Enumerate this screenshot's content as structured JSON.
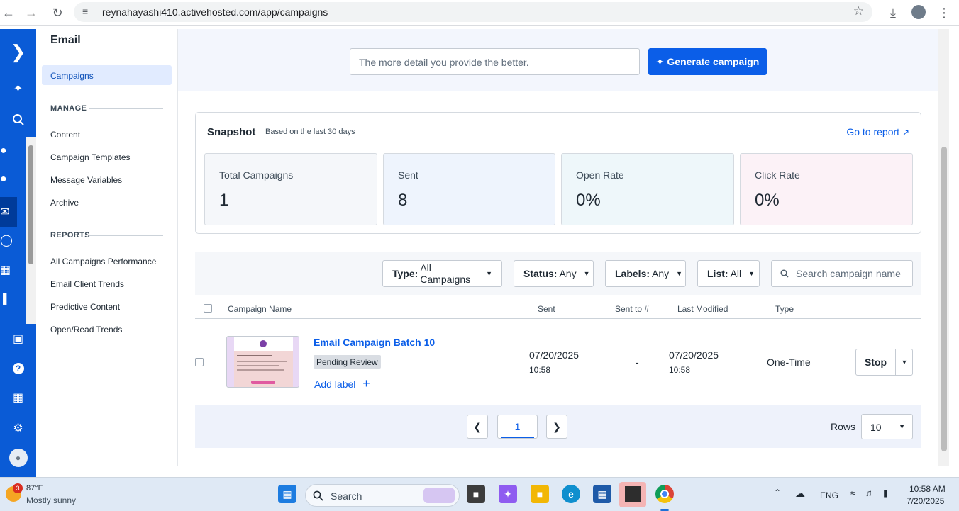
{
  "browser": {
    "url": "reynahayashi410.activehosted.com/app/campaigns"
  },
  "sidebar": {
    "title": "Email",
    "active_item": "Campaigns",
    "manage_heading": "MANAGE",
    "manage_items": [
      "Content",
      "Campaign Templates",
      "Message Variables",
      "Archive"
    ],
    "reports_heading": "REPORTS",
    "report_items": [
      "All Campaigns Performance",
      "Email Client Trends",
      "Predictive Content",
      "Open/Read Trends"
    ]
  },
  "generator": {
    "placeholder": "The more detail you provide the better.",
    "button_label": "Generate campaign"
  },
  "snapshot": {
    "title": "Snapshot",
    "subtitle": "Based on the last 30 days",
    "report_link": "Go to report",
    "stats": [
      {
        "label": "Total Campaigns",
        "value": "1",
        "color": "#f5f7fa"
      },
      {
        "label": "Sent",
        "value": "8",
        "color": "#eef4fd"
      },
      {
        "label": "Open Rate",
        "value": "0%",
        "color": "#eef7fa"
      },
      {
        "label": "Click Rate",
        "value": "0%",
        "color": "#fcf2f7"
      }
    ]
  },
  "filters": {
    "type": {
      "label": "Type:",
      "value": "All Campaigns"
    },
    "status": {
      "label": "Status:",
      "value": "Any"
    },
    "labels": {
      "label": "Labels:",
      "value": "Any"
    },
    "list": {
      "label": "List:",
      "value": "All"
    },
    "search_placeholder": "Search campaign name"
  },
  "table": {
    "headers": {
      "name": "Campaign Name",
      "sent": "Sent",
      "sent_to": "Sent to #",
      "modified": "Last Modified",
      "type": "Type"
    },
    "rows": [
      {
        "name": "Email Campaign Batch 10",
        "status": "Pending Review",
        "add_label": "Add label",
        "sent_date": "07/20/2025",
        "sent_time": "10:58",
        "sent_to": "-",
        "modified_date": "07/20/2025",
        "modified_time": "10:58",
        "type": "One-Time",
        "action": "Stop"
      }
    ]
  },
  "pagination": {
    "current_page": "1",
    "rows_label": "Rows",
    "rows_value": "10"
  },
  "taskbar": {
    "weather_badge": "3",
    "temperature": "87°F",
    "weather": "Mostly sunny",
    "search_label": "Search",
    "language": "ENG",
    "time": "10:58 AM",
    "date": "7/20/2025"
  },
  "colors": {
    "brand": "#0a5bd6",
    "link": "#0b5ee8"
  }
}
